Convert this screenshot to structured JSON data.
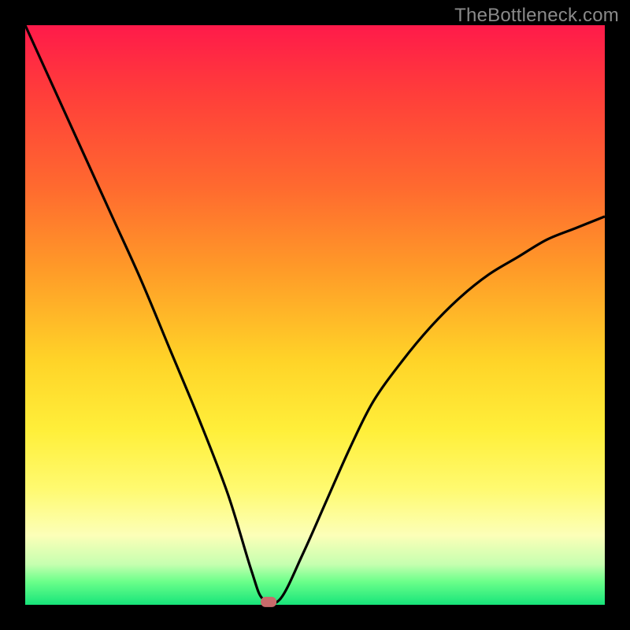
{
  "watermark": "TheBottleneck.com",
  "chart_data": {
    "type": "line",
    "title": "",
    "xlabel": "",
    "ylabel": "",
    "xlim": [
      0,
      100
    ],
    "ylim": [
      0,
      100
    ],
    "x": [
      0,
      5,
      10,
      15,
      20,
      25,
      30,
      35,
      39,
      41,
      44,
      48,
      52,
      56,
      60,
      65,
      70,
      75,
      80,
      85,
      90,
      95,
      100
    ],
    "values": [
      100,
      89,
      78,
      67,
      56,
      44,
      32,
      19,
      6,
      1,
      1,
      9,
      18,
      27,
      35,
      42,
      48,
      53,
      57,
      60,
      63,
      65,
      67
    ],
    "marker": {
      "x": 42,
      "y": 0.5,
      "color": "#c86b6b"
    },
    "background_gradient": [
      "#ff1a4a",
      "#ffd428",
      "#fcffb8",
      "#17e47a"
    ]
  }
}
